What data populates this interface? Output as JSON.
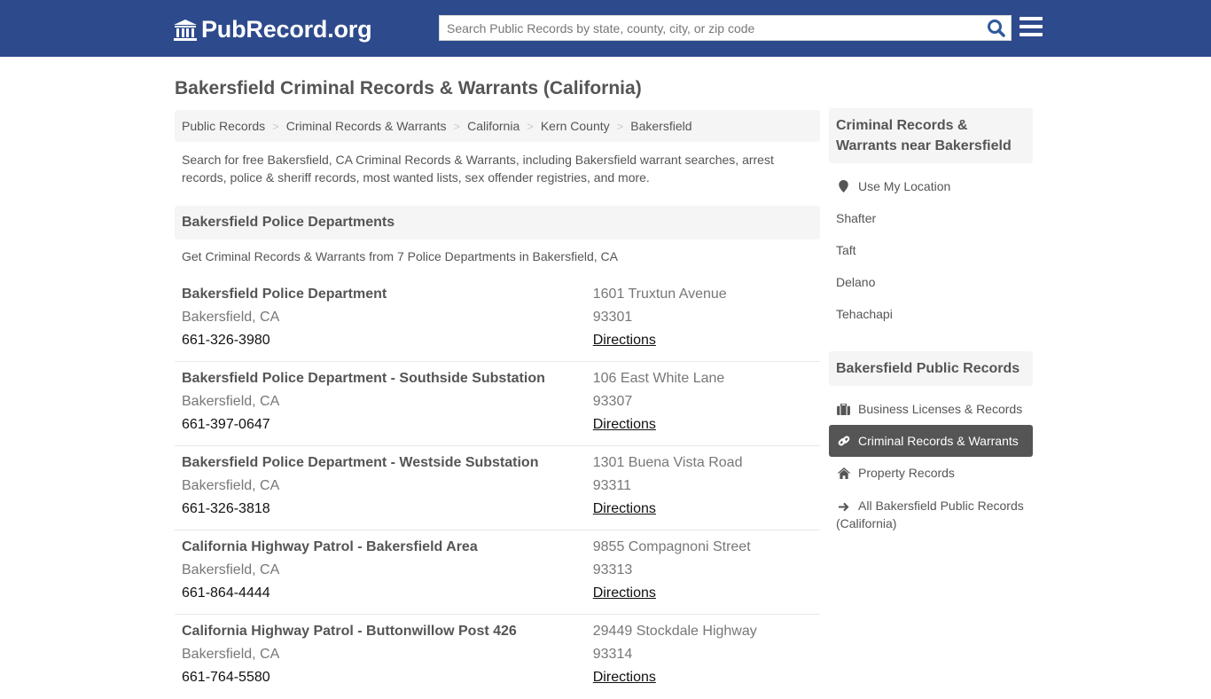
{
  "header": {
    "logo_text": "PubRecord.org",
    "search_placeholder": "Search Public Records by state, county, city, or zip code",
    "brand_color": "#2d4a8c"
  },
  "page": {
    "title": "Bakersfield Criminal Records & Warrants (California)",
    "breadcrumb": [
      "Public Records",
      "Criminal Records & Warrants",
      "California",
      "Kern County",
      "Bakersfield"
    ],
    "intro": "Search for free Bakersfield, CA Criminal Records & Warrants, including Bakersfield warrant searches, arrest records, police & sheriff records, most wanted lists, sex offender registries, and more."
  },
  "section": {
    "title": "Bakersfield Police Departments",
    "subtitle": "Get Criminal Records & Warrants from 7 Police Departments in Bakersfield, CA",
    "items": [
      {
        "name": "Bakersfield Police Department",
        "city": "Bakersfield, CA",
        "phone": "661-326-3980",
        "address": "1601 Truxtun Avenue",
        "zip": "93301",
        "directions": "Directions"
      },
      {
        "name": "Bakersfield Police Department - Southside Substation",
        "city": "Bakersfield, CA",
        "phone": "661-397-0647",
        "address": "106 East White Lane",
        "zip": "93307",
        "directions": "Directions"
      },
      {
        "name": "Bakersfield Police Department - Westside Substation",
        "city": "Bakersfield, CA",
        "phone": "661-326-3818",
        "address": "1301 Buena Vista Road",
        "zip": "93311",
        "directions": "Directions"
      },
      {
        "name": "California Highway Patrol - Bakersfield Area",
        "city": "Bakersfield, CA",
        "phone": "661-864-4444",
        "address": "9855 Compagnoni Street",
        "zip": "93313",
        "directions": "Directions"
      },
      {
        "name": "California Highway Patrol - Buttonwillow Post 426",
        "city": "Bakersfield, CA",
        "phone": "661-764-5580",
        "address": "29449 Stockdale Highway",
        "zip": "93314",
        "directions": "Directions"
      }
    ]
  },
  "sidebar": {
    "nearby": {
      "title": "Criminal Records & Warrants near Bakersfield",
      "use_location": "Use My Location",
      "cities": [
        "Shafter",
        "Taft",
        "Delano",
        "Tehachapi"
      ]
    },
    "public_records": {
      "title": "Bakersfield Public Records",
      "items": [
        {
          "label": "Business Licenses & Records",
          "icon": "briefcase-icon",
          "active": false
        },
        {
          "label": "Criminal Records & Warrants",
          "icon": "link-icon",
          "active": true
        },
        {
          "label": "Property Records",
          "icon": "home-icon",
          "active": false
        },
        {
          "label": "All Bakersfield Public Records (California)",
          "icon": "arrow-right-icon",
          "active": false
        }
      ]
    }
  }
}
